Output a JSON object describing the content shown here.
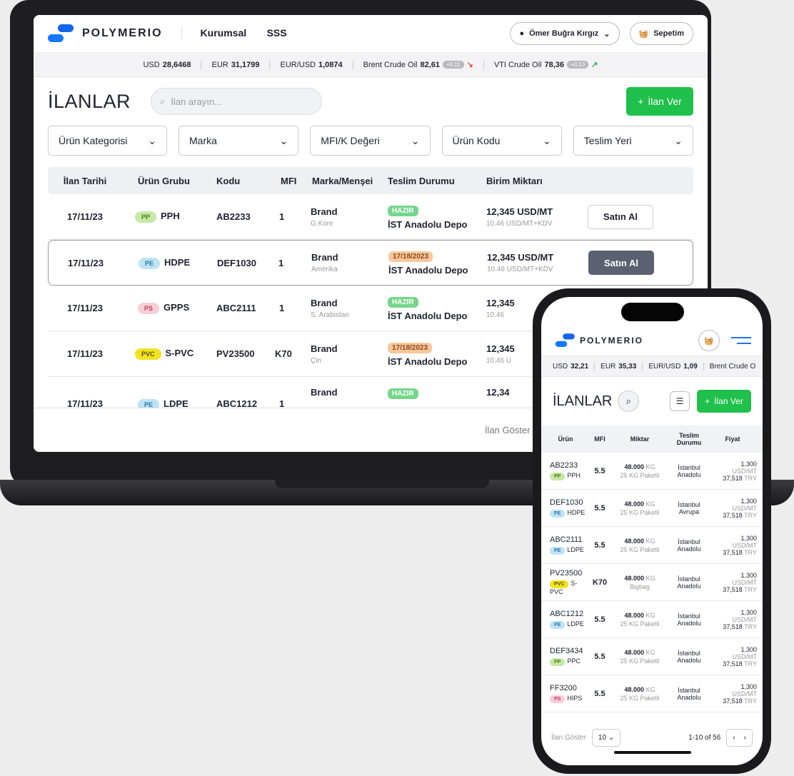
{
  "brand": "POLYMERIO",
  "nav": [
    "Kurumsal",
    "SSS"
  ],
  "user_name": "Ömer Buğra Kırgız",
  "cart_label": "Sepetim",
  "ticker": [
    {
      "label": "USD",
      "value": "28,6468"
    },
    {
      "label": "EUR",
      "value": "31,1799"
    },
    {
      "label": "EUR/USD",
      "value": "1,0874"
    },
    {
      "label": "Brent Crude Oil",
      "value": "82,61",
      "change": "+0,11"
    },
    {
      "label": "VTI Crude Oil",
      "value": "78,36",
      "change": "+0,13"
    }
  ],
  "page_title": "İLANLAR",
  "search_placeholder": "İlan arayın...",
  "add_button": "İlan Ver",
  "filters": [
    "Ürün Kategorisi",
    "Marka",
    "MFI/K Değeri",
    "Ürün Kodu",
    "Teslim Yeri"
  ],
  "table_headers": [
    "İlan Tarihi",
    "Ürün Grubu",
    "Kodu",
    "MFI",
    "Marka/Menşei",
    "Teslim Durumu",
    "Birim Miktarı"
  ],
  "rows": [
    {
      "date": "17/11/23",
      "group": "PP",
      "product": "PPH",
      "code": "AB2233",
      "mfi": "1",
      "brand": "Brand",
      "origin": "G.Kore",
      "status": "HAZIR",
      "delivery": "İST Anadolu Depo",
      "price": "12,345 USD/MT",
      "price_kdv": "10.46 USD/MT+KDV",
      "buy": "Satın Al"
    },
    {
      "date": "17/11/23",
      "group": "PE",
      "product": "HDPE",
      "code": "DEF1030",
      "mfi": "1",
      "brand": "Brand",
      "origin": "Amerika",
      "status": "17/18/2023",
      "delivery": "İST Anadolu Depo",
      "price": "12,345 USD/MT",
      "price_kdv": "10.46 USD/MT+KDV",
      "buy": "Satın Al"
    },
    {
      "date": "17/11/23",
      "group": "PS",
      "product": "GPPS",
      "code": "ABC2111",
      "mfi": "1",
      "brand": "Brand",
      "origin": "S. Arabistan",
      "status": "HAZIR",
      "delivery": "İST Anadolu Depo",
      "price": "12,345",
      "price_kdv": "10.46"
    },
    {
      "date": "17/11/23",
      "group": "PVC",
      "product": "S-PVC",
      "code": "PV23500",
      "mfi": "K70",
      "brand": "Brand",
      "origin": "Çin",
      "status": "17/18/2023",
      "delivery": "İST Anadolu Depo",
      "price": "12,345",
      "price_kdv": "10.46 U"
    },
    {
      "date": "17/11/23",
      "group": "PE",
      "product": "LDPE",
      "code": "ABC1212",
      "mfi": "1",
      "brand": "Brand",
      "origin": "",
      "status": "HAZIR",
      "delivery": "",
      "price": "12,34",
      "price_kdv": ""
    }
  ],
  "footer_label": "İlan Göster",
  "footer_value": "10",
  "mobile": {
    "brand": "POLYMERIO",
    "ticker": [
      {
        "label": "USD",
        "value": "32,21"
      },
      {
        "label": "EUR",
        "value": "35,33"
      },
      {
        "label": "EUR/USD",
        "value": "1,09"
      },
      {
        "label": "Brent Crude O",
        "value": ""
      }
    ],
    "page_title": "İLANLAR",
    "add_button": "İlan Ver",
    "headers": [
      "Ürün",
      "MFI",
      "Miktar",
      "Teslim Durumu",
      "Fiyat"
    ],
    "rows": [
      {
        "code": "AB2233",
        "group": "PP",
        "product": "PPH",
        "mfi": "5.5",
        "qty": "48.000",
        "unit": "KG",
        "pack": "25 KG Paketli",
        "loc1": "İstanbul",
        "loc2": "Anadolu",
        "p1": "1,300",
        "p2": "USD/MT",
        "p3": "37,518",
        "p4": "TRY"
      },
      {
        "code": "DEF1030",
        "group": "PE",
        "product": "HDPE",
        "mfi": "5.5",
        "qty": "48.000",
        "unit": "KG",
        "pack": "25 KG Paketli",
        "loc1": "İstanbul",
        "loc2": "Avrupa",
        "p1": "1,300",
        "p2": "USD/MT",
        "p3": "37,518",
        "p4": "TRY"
      },
      {
        "code": "ABC2111",
        "group": "PE",
        "product": "LDPE",
        "mfi": "5.5",
        "qty": "48.000",
        "unit": "KG",
        "pack": "25 KG Paketli",
        "loc1": "İstanbul",
        "loc2": "Anadolu",
        "p1": "1,300",
        "p2": "USD/MT",
        "p3": "37,518",
        "p4": "TRY"
      },
      {
        "code": "PV23500",
        "group": "PVC",
        "product": "S-PVC",
        "mfi": "K70",
        "qty": "48.000",
        "unit": "KG",
        "pack": "Bigbag",
        "loc1": "İstanbul",
        "loc2": "Anadolu",
        "p1": "1,300",
        "p2": "USD/MT",
        "p3": "37,518",
        "p4": "TRY"
      },
      {
        "code": "ABC1212",
        "group": "PE",
        "product": "LDPE",
        "mfi": "5.5",
        "qty": "48.000",
        "unit": "KG",
        "pack": "25 KG Paketli",
        "loc1": "İstanbul",
        "loc2": "Anadolu",
        "p1": "1,300",
        "p2": "USD/MT",
        "p3": "37,518",
        "p4": "TRY"
      },
      {
        "code": "DEF3434",
        "group": "PP",
        "product": "PPC",
        "mfi": "5.5",
        "qty": "48.000",
        "unit": "KG",
        "pack": "25 KG Paketli",
        "loc1": "İstanbul",
        "loc2": "Anadolu",
        "p1": "1,300",
        "p2": "USD/MT",
        "p3": "37,518",
        "p4": "TRY"
      },
      {
        "code": "FF3200",
        "group": "PS",
        "product": "HIPS",
        "mfi": "5.5",
        "qty": "48.000",
        "unit": "KG",
        "pack": "25 KG Paketli",
        "loc1": "İstanbul",
        "loc2": "Anadolu",
        "p1": "1,300",
        "p2": "USD/MT",
        "p3": "37,518",
        "p4": "TRY"
      }
    ],
    "footer_label": "İlan Göster",
    "footer_value": "10",
    "pagination": "1-10 of 56"
  }
}
